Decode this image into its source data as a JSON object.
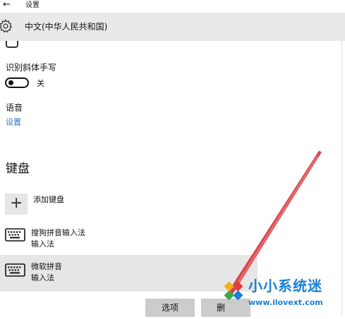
{
  "window": {
    "title": "设置",
    "back_icon": "←"
  },
  "header": {
    "title": "中文(中华人民共和国)",
    "icon": "gear-icon"
  },
  "handwriting": {
    "label": "识别斜体手写",
    "toggle_state": "关",
    "toggle_on": false
  },
  "speech": {
    "label": "语音",
    "link": "设置"
  },
  "keyboards": {
    "section_title": "键盘",
    "add_label": "添加键盘",
    "add_icon": "+",
    "items": [
      {
        "name": "搜狗拼音输入法",
        "type": "输入法",
        "icon": "keyboard-icon",
        "selected": false
      },
      {
        "name": "微软拼音",
        "type": "输入法",
        "icon": "keyboard-icon",
        "selected": true
      }
    ],
    "options_button": "选项",
    "delete_button": "删"
  },
  "watermark": {
    "name": "小小系统迷",
    "url": "www.ilovext.com"
  },
  "colors": {
    "accent": "#2a76c6",
    "header_bg": "#e9e9e9",
    "selected_bg": "#e6e6e6",
    "button_bg": "#cccccc",
    "pointer": "#d4343a",
    "watermark": "#1a7fd6"
  }
}
